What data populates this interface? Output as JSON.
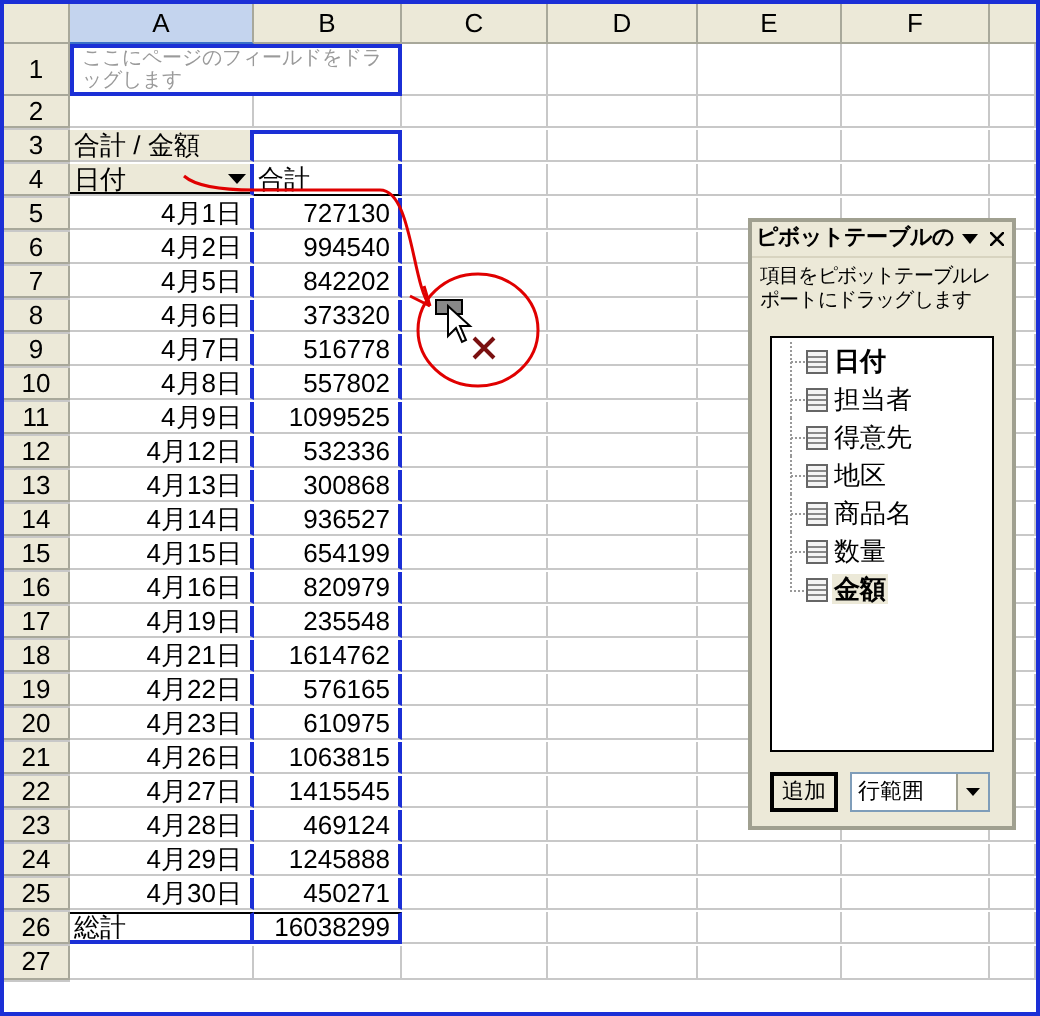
{
  "columns": [
    {
      "label": "A",
      "selected": true
    },
    {
      "label": "B",
      "selected": false
    },
    {
      "label": "C",
      "selected": false
    },
    {
      "label": "D",
      "selected": false
    },
    {
      "label": "E",
      "selected": false
    },
    {
      "label": "F",
      "selected": false
    }
  ],
  "row_numbers": [
    "1",
    "2",
    "3",
    "4",
    "5",
    "6",
    "7",
    "8",
    "9",
    "10",
    "11",
    "12",
    "13",
    "14",
    "15",
    "16",
    "17",
    "18",
    "19",
    "20",
    "21",
    "22",
    "23",
    "24",
    "25",
    "26",
    "27"
  ],
  "page_area": {
    "hint": "ここにページのフィールドをドラッグします"
  },
  "data_field": "合計 / 金額",
  "row_field": "日付",
  "value_header": "合計",
  "rows": [
    {
      "date": "4月1日",
      "value": "727130"
    },
    {
      "date": "4月2日",
      "value": "994540"
    },
    {
      "date": "4月5日",
      "value": "842202"
    },
    {
      "date": "4月6日",
      "value": "373320"
    },
    {
      "date": "4月7日",
      "value": "516778"
    },
    {
      "date": "4月8日",
      "value": "557802"
    },
    {
      "date": "4月9日",
      "value": "1099525"
    },
    {
      "date": "4月12日",
      "value": "532336"
    },
    {
      "date": "4月13日",
      "value": "300868"
    },
    {
      "date": "4月14日",
      "value": "936527"
    },
    {
      "date": "4月15日",
      "value": "654199"
    },
    {
      "date": "4月16日",
      "value": "820979"
    },
    {
      "date": "4月19日",
      "value": "235548"
    },
    {
      "date": "4月21日",
      "value": "1614762"
    },
    {
      "date": "4月22日",
      "value": "576165"
    },
    {
      "date": "4月23日",
      "value": "610975"
    },
    {
      "date": "4月26日",
      "value": "1063815"
    },
    {
      "date": "4月27日",
      "value": "1415545"
    },
    {
      "date": "4月28日",
      "value": "469124"
    },
    {
      "date": "4月29日",
      "value": "1245888"
    },
    {
      "date": "4月30日",
      "value": "450271"
    }
  ],
  "total": {
    "label": "総計",
    "value": "16038299"
  },
  "pivot_panel": {
    "title": "ピボットテーブルの",
    "instructions": "項目をピボットテーブルレポートにドラッグします",
    "fields": [
      {
        "label": "日付",
        "used": true,
        "selected": false
      },
      {
        "label": "担当者",
        "used": false,
        "selected": false
      },
      {
        "label": "得意先",
        "used": false,
        "selected": false
      },
      {
        "label": "地区",
        "used": false,
        "selected": false
      },
      {
        "label": "商品名",
        "used": false,
        "selected": false
      },
      {
        "label": "数量",
        "used": false,
        "selected": false
      },
      {
        "label": "金額",
        "used": true,
        "selected": true
      }
    ],
    "add_button": "追加",
    "area_select": "行範囲"
  }
}
